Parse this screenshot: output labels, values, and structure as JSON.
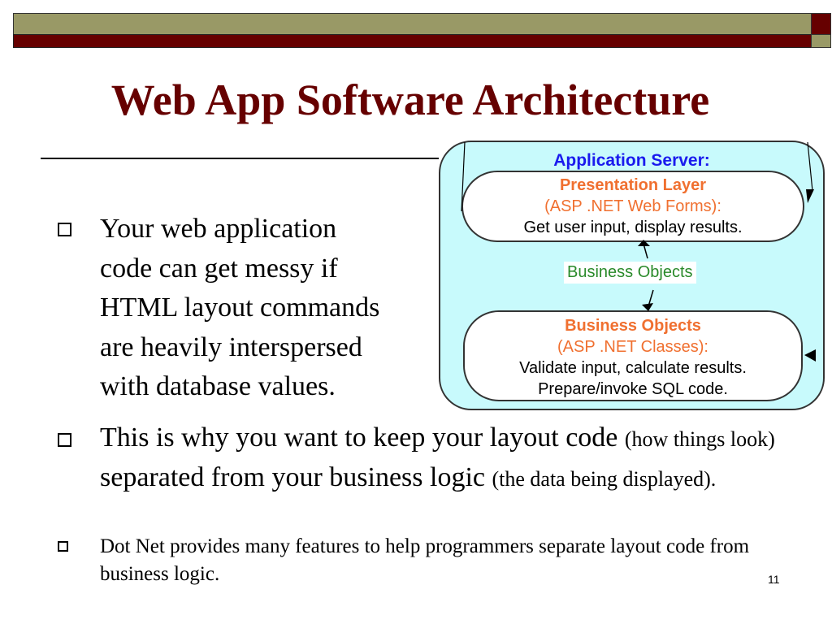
{
  "title": "Web App Software Architecture",
  "bullets": [
    {
      "lines": [
        "Your web application",
        "code can get messy if",
        "HTML layout commands",
        "are heavily interspersed",
        "with database values."
      ]
    },
    {
      "part1": "This is why you want to keep your layout code ",
      "part2": "(how things look)",
      "part3": " separated from your business logic ",
      "part4": "(the data being displayed)."
    },
    {
      "text": "Dot Net provides many features to help programmers separate layout code from business logic."
    }
  ],
  "diagram": {
    "header": "Application Server:",
    "presentation": {
      "title": "Presentation Layer",
      "subtitle": "(ASP .NET Web Forms):",
      "desc": "Get user input, display results."
    },
    "link_label": "Business Objects",
    "business": {
      "title": "Business Objects",
      "subtitle": "(ASP .NET Classes):",
      "desc1": "Validate input, calculate results.",
      "desc2": "Prepare/invoke SQL code."
    }
  },
  "page_number": "11"
}
